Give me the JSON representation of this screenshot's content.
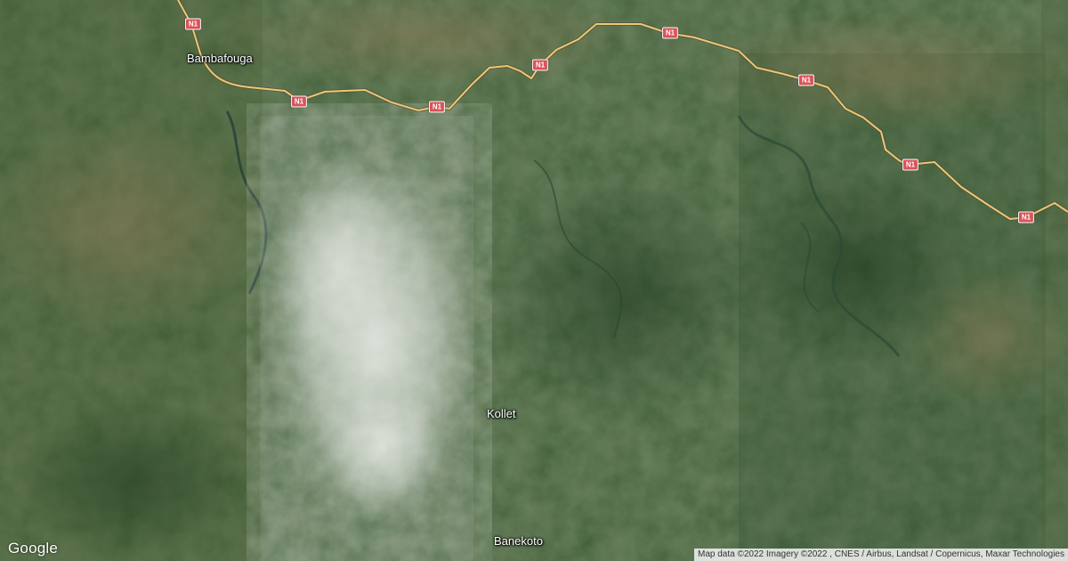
{
  "map": {
    "type": "satellite",
    "places": [
      {
        "id": "bambafouga",
        "name": "Bambafouga"
      },
      {
        "id": "kollet",
        "name": "Kollet"
      },
      {
        "id": "banekoto",
        "name": "Banekoto"
      }
    ],
    "road": {
      "name": "N1",
      "shield_color": "#d9545a",
      "line_color": "#e8c97a"
    },
    "colors": {
      "forest": "#33512d",
      "cloud": "#d8dcd8",
      "river": "#27433c"
    }
  },
  "branding": {
    "logo": "Google"
  },
  "attribution": "Map data ©2022 Imagery ©2022 , CNES / Airbus, Landsat / Copernicus, Maxar Technologies"
}
